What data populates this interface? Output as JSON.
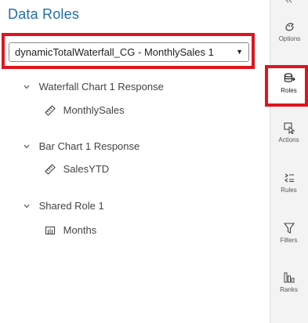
{
  "panel": {
    "title": "Data Roles",
    "selector_value": "dynamicTotalWaterfall_CG - MonthlySales 1"
  },
  "groups": [
    {
      "label": "Waterfall Chart 1 Response",
      "item": "MonthlySales",
      "item_icon": "measure-icon"
    },
    {
      "label": "Bar Chart 1 Response",
      "item": "SalesYTD",
      "item_icon": "measure-icon"
    },
    {
      "label": "Shared Role 1",
      "item": "Months",
      "item_icon": "category-icon"
    }
  ],
  "sidebar": {
    "items": [
      {
        "label": "Options",
        "icon": "options-icon"
      },
      {
        "label": "Roles",
        "icon": "roles-icon",
        "selected": true
      },
      {
        "label": "Actions",
        "icon": "actions-icon"
      },
      {
        "label": "Rules",
        "icon": "rules-icon"
      },
      {
        "label": "Filters",
        "icon": "filters-icon"
      },
      {
        "label": "Ranks",
        "icon": "ranks-icon"
      }
    ]
  },
  "colors": {
    "accent": "#1f6fa9",
    "highlight": "#e0141e"
  }
}
